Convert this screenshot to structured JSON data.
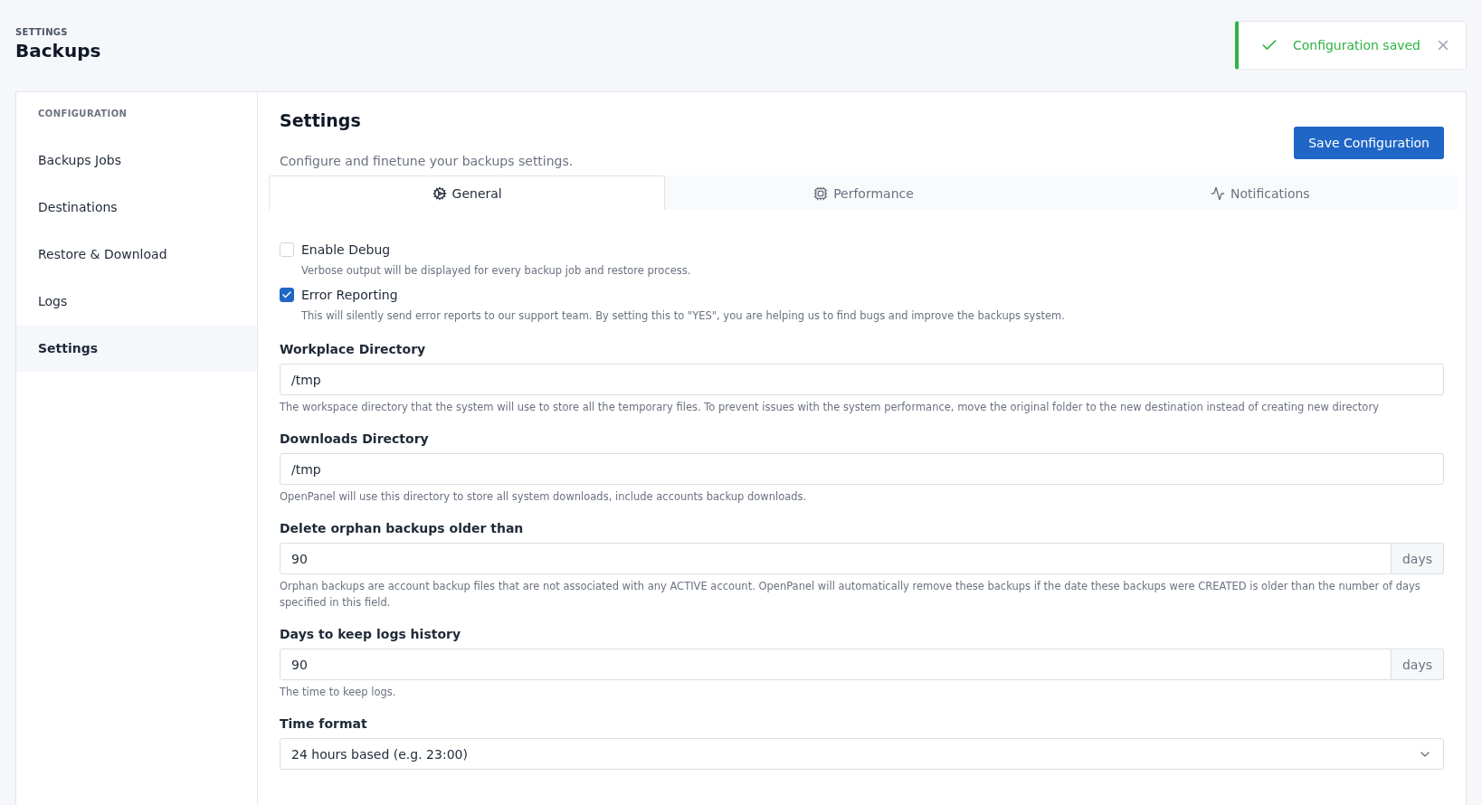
{
  "header": {
    "eyebrow": "SETTINGS",
    "title": "Backups"
  },
  "toast": {
    "message": "Configuration saved"
  },
  "sidebar": {
    "heading": "CONFIGURATION",
    "items": [
      {
        "label": "Backups Jobs",
        "selected": false
      },
      {
        "label": "Destinations",
        "selected": false
      },
      {
        "label": "Restore & Download",
        "selected": false
      },
      {
        "label": "Logs",
        "selected": false
      },
      {
        "label": "Settings",
        "selected": true
      }
    ]
  },
  "panel": {
    "title": "Settings",
    "description": "Configure and finetune your backups settings.",
    "save_button": "Save Configuration",
    "tabs": [
      {
        "label": "General",
        "kind": "gear",
        "selected": true
      },
      {
        "label": "Performance",
        "kind": "chip",
        "selected": false
      },
      {
        "label": "Notifications",
        "kind": "pulse",
        "selected": false
      }
    ],
    "checkboxes": [
      {
        "label": "Enable Debug",
        "description": "Verbose output will be displayed for every backup job and restore process.",
        "checked": false
      },
      {
        "label": "Error Reporting",
        "description": "This will silently send error reports to our support team. By setting this to \"YES\", you are helping us to find bugs and improve the backups system.",
        "checked": true
      }
    ],
    "fields": [
      {
        "kind": "text",
        "label": "Workplace Directory",
        "value": "/tmp",
        "help": "The workspace directory that the system will use to store all the temporary files. To prevent issues with the system performance, move the original folder to the new destination instead of creating new directory"
      },
      {
        "kind": "text",
        "label": "Downloads Directory",
        "value": "/tmp",
        "help": "OpenPanel will use this directory to store all system downloads, include accounts backup downloads."
      },
      {
        "kind": "unit",
        "label": "Delete orphan backups older than",
        "value": "90",
        "unit": "days",
        "help": "Orphan backups are account backup files that are not associated with any ACTIVE account. OpenPanel will automatically remove these backups if the date these backups were CREATED is older than the number of days specified in this field."
      },
      {
        "kind": "unit",
        "label": "Days to keep logs history",
        "value": "90",
        "unit": "days",
        "help": "The time to keep logs."
      },
      {
        "kind": "select",
        "label": "Time format",
        "value": "24 hours based (e.g. 23:00)"
      }
    ]
  }
}
